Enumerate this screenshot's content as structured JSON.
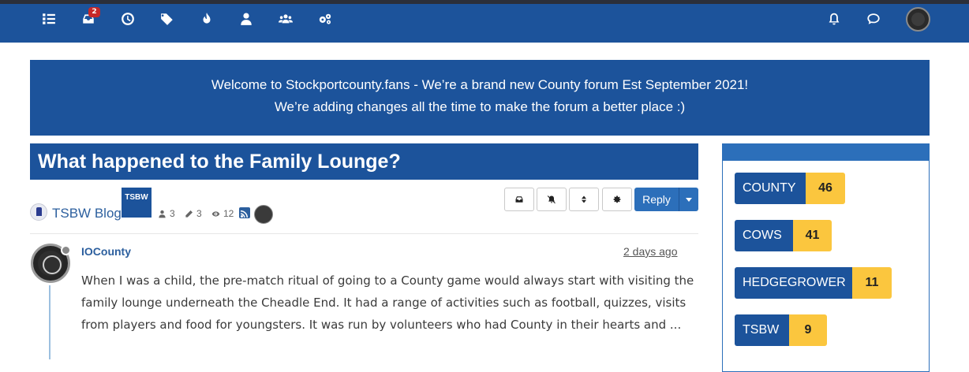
{
  "nav": {
    "left_icons": [
      "list-icon",
      "inbox-icon",
      "clock-icon",
      "tags-icon",
      "fire-icon",
      "user-icon",
      "users-icon",
      "cogs-icon"
    ],
    "inbox_badge": "2",
    "right_icons": [
      "bell-icon",
      "chat-icon"
    ]
  },
  "banner": {
    "line1": "Welcome to Stockportcounty.fans - We’re a brand new County forum Est September 2021!",
    "line2": "We’re adding changes all the time to make the forum a better place :)"
  },
  "topic": {
    "title": "What happened to the Family Lounge?",
    "category": "TSBW Blog",
    "tag": "TSBW",
    "posters": "3",
    "posts": "3",
    "views": "12"
  },
  "actions": {
    "reply_label": "Reply"
  },
  "post": {
    "author": "IOCounty",
    "time": "2 days ago",
    "body": "When I was a child, the pre-match ritual of going to a County game would always start with visiting the family lounge underneath the Cheadle End. It had a range of activities such as football, quizzes, visits from players and food for youngsters. It was run by volunteers who had County in their hearts and ..."
  },
  "sidebar": {
    "leaders": [
      {
        "name": "COUNTY",
        "count": "46"
      },
      {
        "name": "COWS",
        "count": "41"
      },
      {
        "name": "HEDGEGROWER",
        "count": "11"
      },
      {
        "name": "TSBW",
        "count": "9"
      }
    ]
  },
  "colors": {
    "brand": "#1c539b",
    "accent": "#2c6fba",
    "count_badge": "#fbc63e"
  }
}
